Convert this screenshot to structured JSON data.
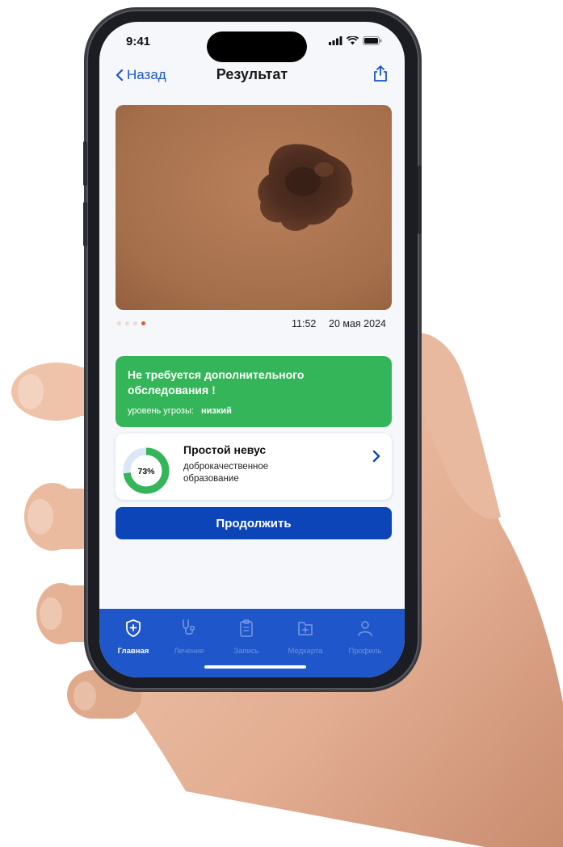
{
  "status_bar": {
    "time": "9:41"
  },
  "nav": {
    "back_label": "Назад",
    "title": "Результат"
  },
  "photo": {
    "page_count": 4,
    "active_index": 3
  },
  "meta": {
    "time": "11:52",
    "date": "20 мая 2024"
  },
  "result": {
    "title": "Не требуется дополнительного обследования !",
    "threat_label": "уровень угрозы:",
    "threat_value": "низкий",
    "color": "#35b559"
  },
  "diagnosis": {
    "percent": 73,
    "percent_text": "73%",
    "title": "Простой невус",
    "description": "доброкачественное образование"
  },
  "continue_button": {
    "label": "Продолжить"
  },
  "tabs": [
    {
      "label": "Главная",
      "icon": "shield-plus-icon",
      "active": true
    },
    {
      "label": "Лечение",
      "icon": "stethoscope-icon",
      "active": false
    },
    {
      "label": "Запись",
      "icon": "clipboard-icon",
      "active": false
    },
    {
      "label": "Медкарта",
      "icon": "medical-folder-icon",
      "active": false
    },
    {
      "label": "Профиль",
      "icon": "person-icon",
      "active": false
    }
  ],
  "colors": {
    "accent": "#0c45b8",
    "tabbar": "#1f56c9",
    "success": "#35b559",
    "link": "#1a56c6"
  }
}
